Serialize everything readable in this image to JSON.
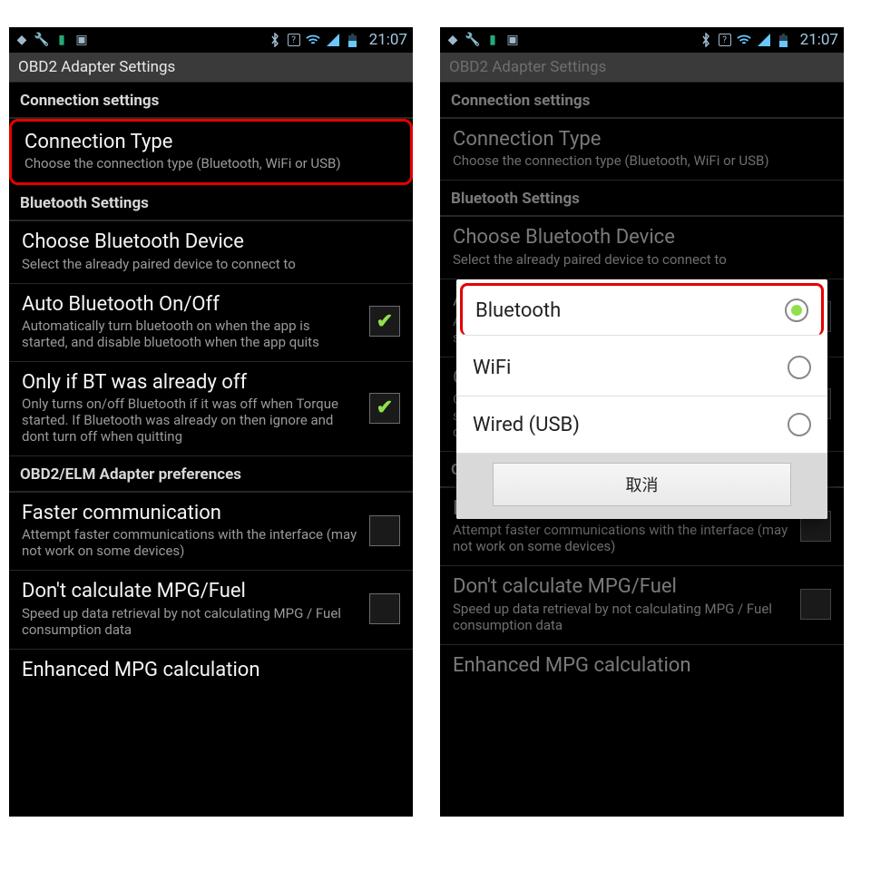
{
  "status": {
    "time": "21:07"
  },
  "titlebar": "OBD2 Adapter Settings",
  "sections": {
    "connection": "Connection settings",
    "bluetooth": "Bluetooth Settings",
    "obd2elm": "OBD2/ELM Adapter preferences"
  },
  "items": {
    "connType": {
      "title": "Connection Type",
      "sub": "Choose the connection type (Bluetooth, WiFi or USB)"
    },
    "chooseBt": {
      "title": "Choose Bluetooth Device",
      "sub": "Select the already paired device to connect to"
    },
    "autoBt": {
      "title": "Auto Bluetooth On/Off",
      "sub": "Automatically turn bluetooth on when the app is started, and disable bluetooth when the app quits"
    },
    "onlyIf": {
      "title": "Only if BT was already off",
      "sub": "Only turns on/off Bluetooth if it was off when Torque started. If Bluetooth was already on then ignore and dont turn off when quitting"
    },
    "faster": {
      "title": "Faster communication",
      "sub": "Attempt faster communications with the interface (may not work on some devices)"
    },
    "nompg": {
      "title": "Don't calculate MPG/Fuel",
      "sub": "Speed up data retrieval by not calculating MPG / Fuel consumption data"
    },
    "enh": {
      "title": "Enhanced MPG calculation"
    }
  },
  "dialog": {
    "options": {
      "bt": "Bluetooth",
      "wifi": "WiFi",
      "wired": "Wired (USB)"
    },
    "cancel": "取消"
  }
}
